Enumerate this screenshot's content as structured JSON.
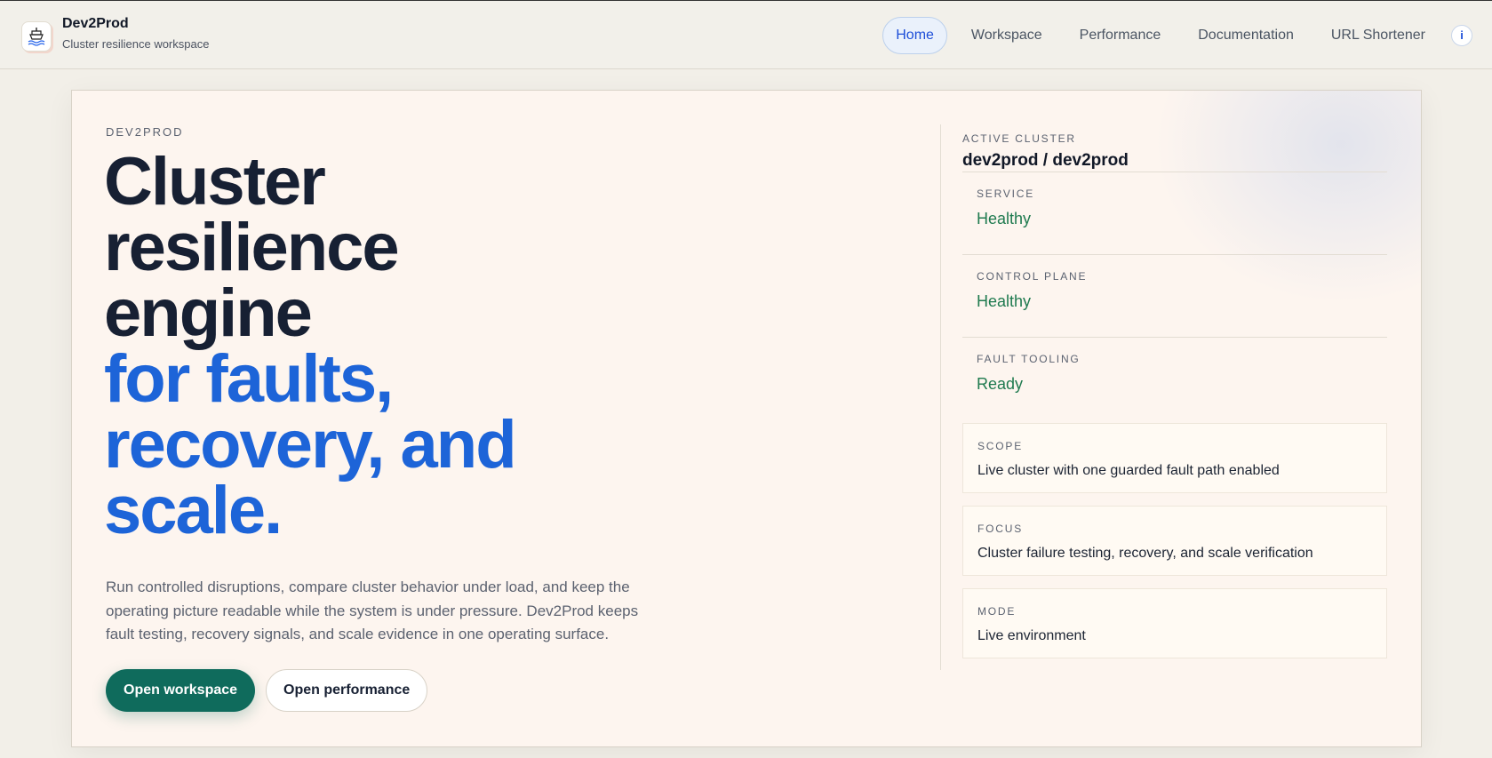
{
  "header": {
    "brand_name": "Dev2Prod",
    "brand_subtitle": "Cluster resilience workspace",
    "logo_icon": "ship-icon",
    "nav": [
      {
        "label": "Home",
        "active": true
      },
      {
        "label": "Workspace",
        "active": false
      },
      {
        "label": "Performance",
        "active": false
      },
      {
        "label": "Documentation",
        "active": false
      },
      {
        "label": "URL Shortener",
        "active": false
      }
    ],
    "info_label": "i"
  },
  "hero": {
    "eyebrow": "DEV2PROD",
    "headline_dark": [
      "Cluster",
      "resilience",
      "engine"
    ],
    "headline_blue": [
      "for faults,",
      "recovery, and",
      "scale."
    ],
    "lede": "Run controlled disruptions, compare cluster behavior under load, and keep the operating picture readable while the system is under pressure. Dev2Prod keeps fault testing, recovery signals, and scale evidence in one operating surface.",
    "primary_button": "Open workspace",
    "secondary_button": "Open performance"
  },
  "panel": {
    "label": "ACTIVE CLUSTER",
    "title": "dev2prod / dev2prod",
    "statuses": [
      {
        "label": "SERVICE",
        "value": "Healthy"
      },
      {
        "label": "CONTROL PLANE",
        "value": "Healthy"
      },
      {
        "label": "FAULT TOOLING",
        "value": "Ready"
      }
    ],
    "cards": [
      {
        "label": "SCOPE",
        "value": "Live cluster with one guarded fault path enabled"
      },
      {
        "label": "FOCUS",
        "value": "Cluster failure testing, recovery, and scale verification"
      },
      {
        "label": "MODE",
        "value": "Live environment"
      }
    ]
  },
  "colors": {
    "accent_blue": "#1d64d8",
    "primary_green": "#0f6b5c",
    "status_green": "#1f7a4f"
  }
}
